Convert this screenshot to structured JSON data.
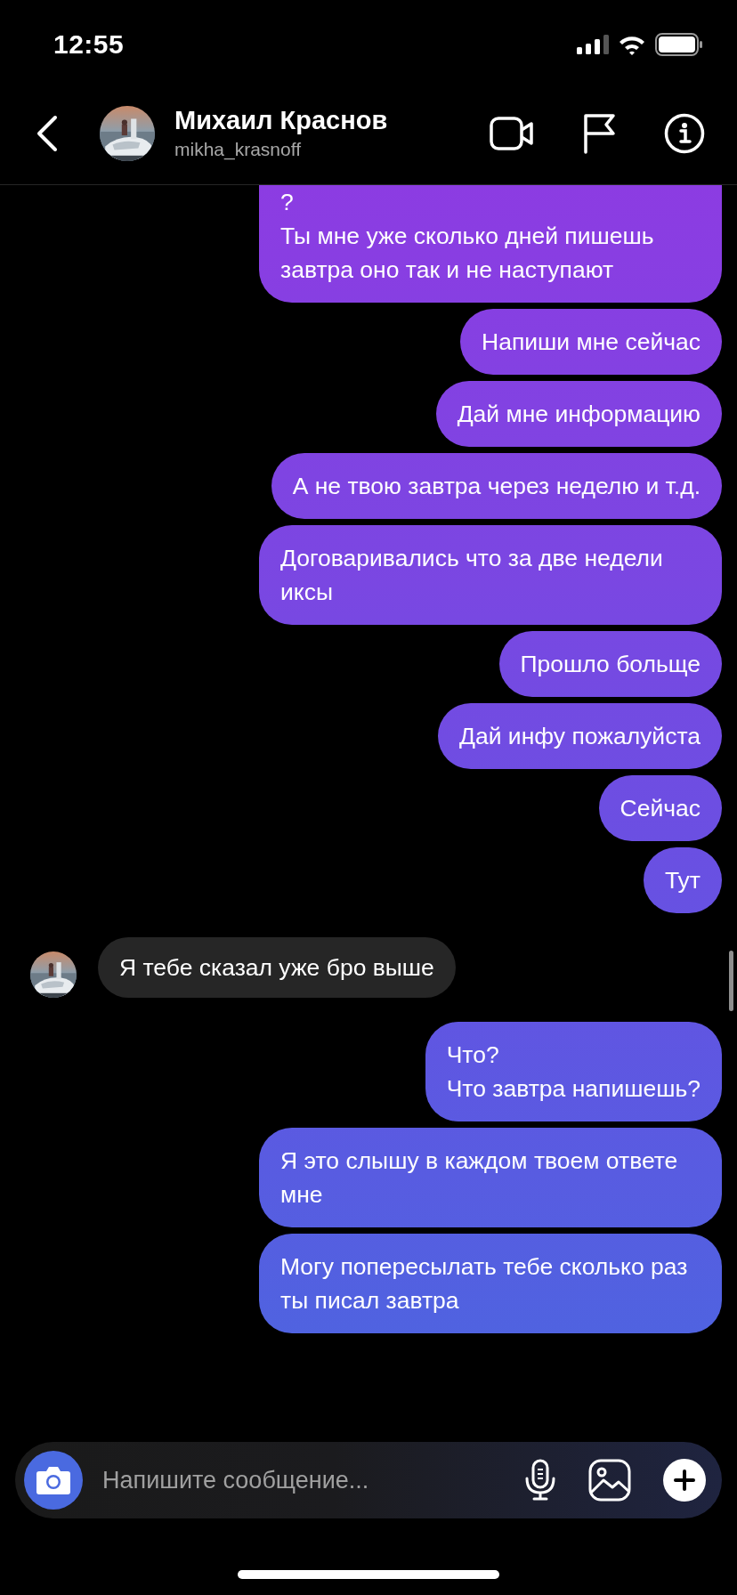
{
  "status_bar": {
    "time": "12:55"
  },
  "header": {
    "name": "Михаил Краснов",
    "username": "mikha_krasnoff"
  },
  "messages": [
    {
      "kind": "sent",
      "text": "?\nТы мне уже сколько дней пишешь завтра оно так и не наступают"
    },
    {
      "kind": "sent",
      "text": "Напиши мне сейчас"
    },
    {
      "kind": "sent",
      "text": "Дай мне информацию"
    },
    {
      "kind": "sent",
      "text": "А не твою завтра через неделю и т.д."
    },
    {
      "kind": "sent",
      "text": "Договаривались что за две недели иксы"
    },
    {
      "kind": "sent",
      "text": "Прошло больще"
    },
    {
      "kind": "sent",
      "text": "Дай инфу пожалуйста"
    },
    {
      "kind": "sent",
      "text": "Сейчас"
    },
    {
      "kind": "sent",
      "text": "Тут"
    },
    {
      "kind": "received",
      "text": "Я тебе сказал уже бро выше"
    },
    {
      "kind": "sent",
      "text": "Что?\nЧто завтра напишешь?"
    },
    {
      "kind": "sent",
      "text": "Я это слышу в каждом твоем ответе мне"
    },
    {
      "kind": "sent",
      "text": "Могу попересылать тебе сколько раз ты писал завтра"
    }
  ],
  "composer": {
    "placeholder": "Напишите сообщение..."
  }
}
